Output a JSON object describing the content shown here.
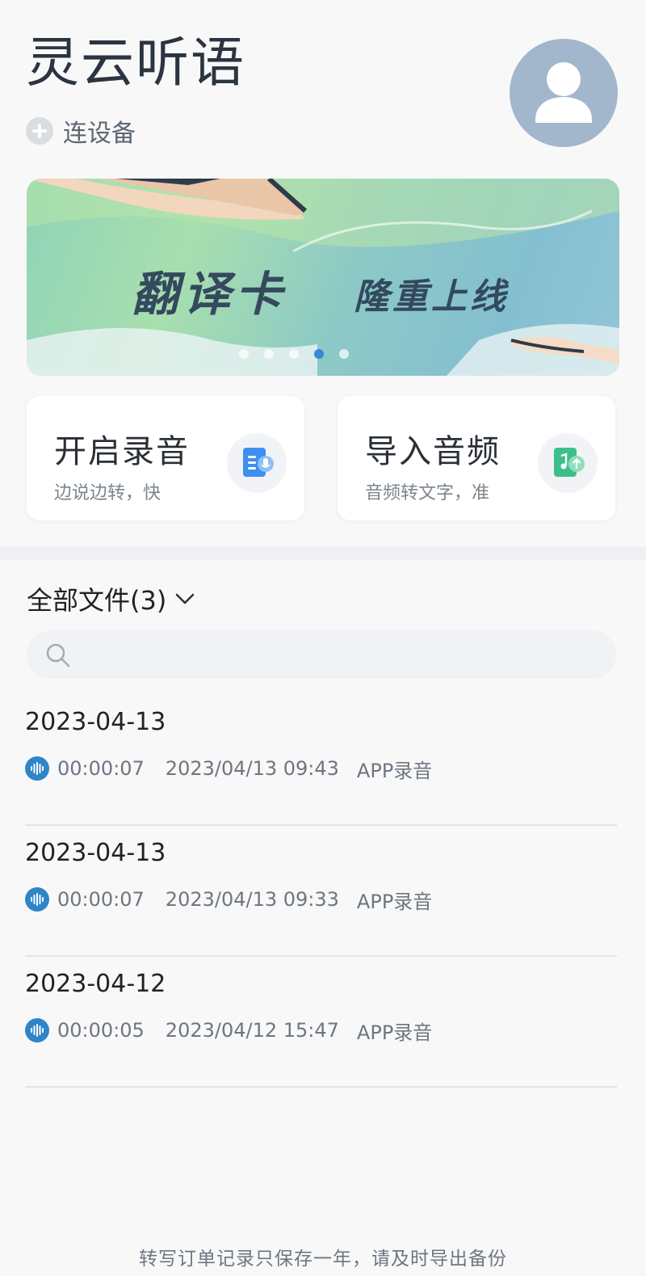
{
  "header": {
    "app_title": "灵云听语",
    "connect_label": "连设备"
  },
  "banner": {
    "title": "翻译卡",
    "subtitle": "隆重上线",
    "page_count": 5,
    "active_page": 4
  },
  "actions": [
    {
      "title": "开启录音",
      "subtitle": "边说边转，快",
      "icon": "record-doc-icon",
      "color": "#3d8ff0"
    },
    {
      "title": "导入音频",
      "subtitle": "音频转文字，准",
      "icon": "import-audio-icon",
      "color": "#3dbf8a"
    }
  ],
  "files": {
    "filter_label": "全部文件(3)",
    "search_placeholder": "",
    "items": [
      {
        "date": "2023-04-13",
        "duration": "00:00:07",
        "timestamp": "2023/04/13 09:43",
        "source": "APP录音"
      },
      {
        "date": "2023-04-13",
        "duration": "00:00:07",
        "timestamp": "2023/04/13 09:33",
        "source": "APP录音"
      },
      {
        "date": "2023-04-12",
        "duration": "00:00:05",
        "timestamp": "2023/04/12 15:47",
        "source": "APP录音"
      }
    ]
  },
  "footer": {
    "note": "转写订单记录只保存一年，请及时导出备份"
  },
  "colors": {
    "accent": "#3b86d8",
    "avatar_bg": "#a2b6cc",
    "wave_icon": "#2e86c8"
  }
}
